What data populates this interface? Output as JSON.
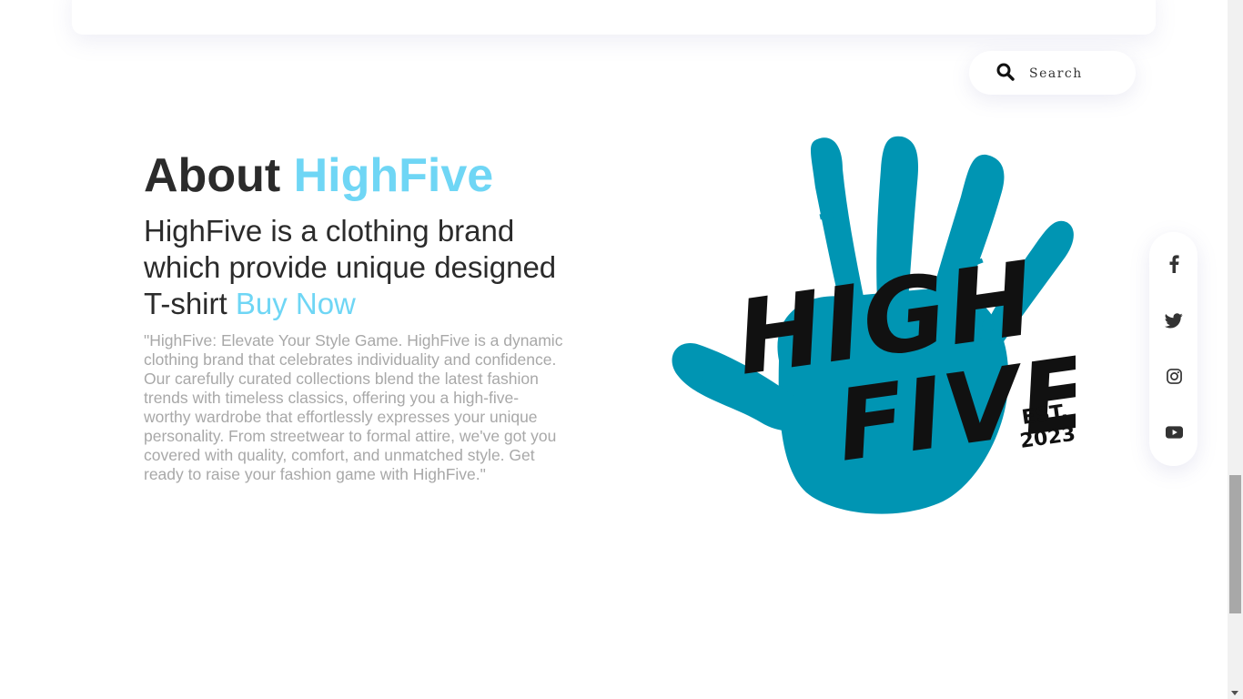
{
  "search": {
    "placeholder": "Search",
    "icon": "search-icon"
  },
  "about": {
    "heading_prefix": "About",
    "heading_brand": "HighFive",
    "tagline": "HighFive is a clothing brand which provide unique designed T-shirt",
    "buy_now_label": "Buy Now",
    "description": "\"HighFive: Elevate Your Style Game. HighFive is a dynamic clothing brand that celebrates individuality and confidence. Our carefully curated collections blend the latest fashion trends with timeless classics, offering you a high-five-worthy wardrobe that effortlessly expresses your unique personality. From streetwear to formal attire, we've got you covered with quality, comfort, and unmatched style. Get ready to raise your fashion game with HighFive.\""
  },
  "logo": {
    "line1": "HIGH",
    "line2": "FIVE",
    "est_label": "EST.",
    "est_year": "2023",
    "hand_color": "#0095b3",
    "text_color": "#111111"
  },
  "social": [
    {
      "name": "facebook-icon"
    },
    {
      "name": "twitter-icon"
    },
    {
      "name": "instagram-icon"
    },
    {
      "name": "youtube-icon"
    }
  ],
  "colors": {
    "accent": "#6fd6f5",
    "heading": "#2b2b2b",
    "body_text": "#a8a8a8"
  }
}
